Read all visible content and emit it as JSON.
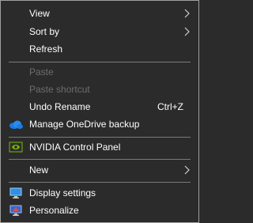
{
  "menu": {
    "items": [
      {
        "label": "View",
        "submenu": true
      },
      {
        "label": "Sort by",
        "submenu": true
      },
      {
        "label": "Refresh"
      },
      {
        "label": "Paste",
        "disabled": true
      },
      {
        "label": "Paste shortcut",
        "disabled": true
      },
      {
        "label": "Undo Rename",
        "shortcut": "Ctrl+Z"
      },
      {
        "label": "Manage OneDrive backup",
        "icon": "onedrive-icon"
      },
      {
        "label": "NVIDIA Control Panel",
        "icon": "nvidia-icon"
      },
      {
        "label": "New",
        "submenu": true
      },
      {
        "label": "Display settings",
        "icon": "display-icon"
      },
      {
        "label": "Personalize",
        "icon": "personalize-icon"
      }
    ]
  },
  "colors": {
    "background": "#2b2b2b",
    "text": "#ffffff",
    "disabled_text": "#6d6d6d",
    "separator": "#7a7a7a",
    "onedrive": "#1e7ae0",
    "nvidia": "#76b900"
  }
}
